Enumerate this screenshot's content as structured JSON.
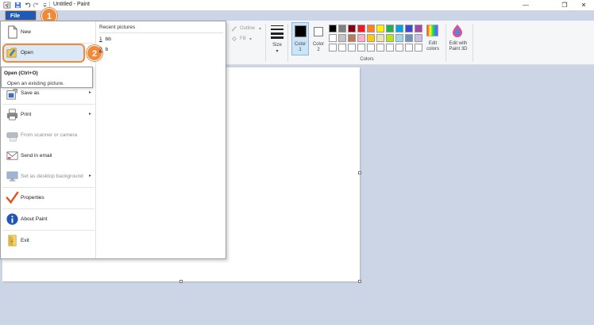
{
  "titlebar": {
    "title": "Untitled - Paint",
    "minimize": "—",
    "maximize": "❐",
    "close": "✕"
  },
  "file_tab": {
    "label": "File"
  },
  "steps": {
    "one": "1",
    "two": "2"
  },
  "ribbon": {
    "outline": "Outline",
    "fill": "Fill",
    "size": "Size",
    "color1": "Color\n1",
    "color2": "Color\n2",
    "edit_colors": "Edit\ncolors",
    "edit_paint3d": "Edit with\nPaint 3D",
    "colors_group": "Colors",
    "color1_value": "#000000",
    "color2_value": "#ffffff",
    "palette_row1": [
      "#000000",
      "#7f7f7f",
      "#880015",
      "#ed1c24",
      "#ff7f27",
      "#fff200",
      "#22b14c",
      "#00a2e8",
      "#3f48cc",
      "#a349a4"
    ],
    "palette_row2": [
      "#ffffff",
      "#c3c3c3",
      "#b97a57",
      "#ffaec9",
      "#ffc90e",
      "#efe4b0",
      "#b5e61d",
      "#99d9ea",
      "#7092be",
      "#c8bfe7"
    ],
    "palette_row3": [
      "#ffffff",
      "#ffffff",
      "#ffffff",
      "#ffffff",
      "#ffffff",
      "#ffffff",
      "#ffffff",
      "#ffffff",
      "#ffffff",
      "#ffffff"
    ]
  },
  "file_menu": {
    "items": {
      "new": "New",
      "open": "Open",
      "save_as": "Save as",
      "print": "Print",
      "scanner": "From scanner or camera",
      "email": "Send in email",
      "desktop_bg": "Set as desktop background",
      "properties": "Properties",
      "about": "About Paint",
      "exit": "Exit"
    },
    "tooltip": {
      "title": "Open (Ctrl+O)",
      "description": "Open an existing picture."
    },
    "recent": {
      "title": "Recent pictures",
      "items": [
        {
          "index": "1",
          "name": "bb"
        },
        {
          "index": "2",
          "name": "b"
        }
      ]
    }
  }
}
